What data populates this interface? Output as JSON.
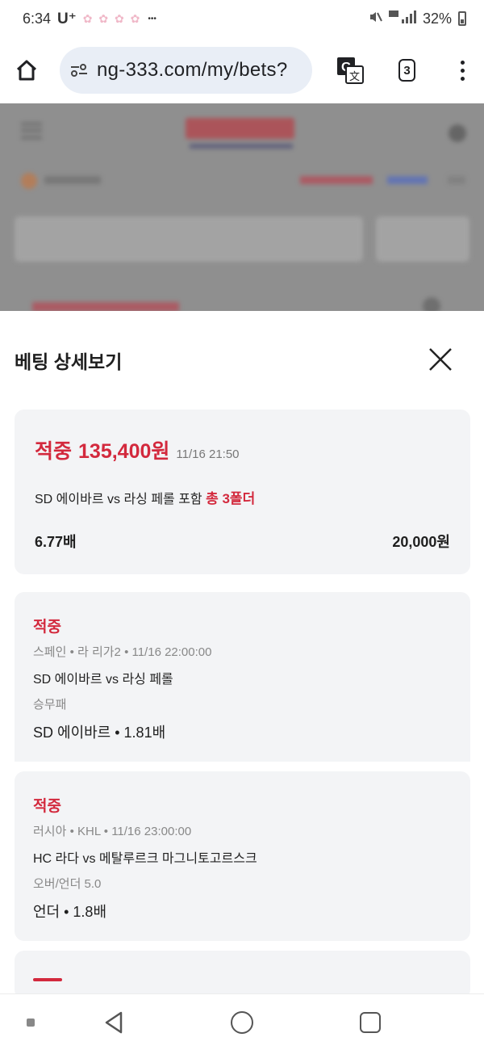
{
  "status_bar": {
    "time": "6:34",
    "carrier": "U⁺",
    "indicators": "✿ ✿ ✿ ✿",
    "more": "•••",
    "signal_text": "▏▎▍▌",
    "battery_percent": "32%"
  },
  "browser": {
    "url": "ng-333.com/my/bets?",
    "tab_count": "3"
  },
  "sheet": {
    "title": "베팅 상세보기"
  },
  "summary": {
    "status": "적중",
    "amount": "135,400원",
    "time": "11/16 21:50",
    "desc_prefix": "SD 에이바르 vs 라싱 페롤 포함",
    "folder_text": "총 3폴더",
    "odds": "6.77배",
    "stake": "20,000원"
  },
  "bets": [
    {
      "status": "적중",
      "league": "스페인 • 라 리가2 • 11/16 22:00:00",
      "match": "SD 에이바르 vs 라싱 페롤",
      "market": "승무패",
      "pick": "SD 에이바르 • 1.81배"
    },
    {
      "status": "적중",
      "league": "러시아 • KHL • 11/16 23:00:00",
      "match": "HC 라다 vs 메탈루르크 마그니토고르스크",
      "market": "오버/언더 5.0",
      "pick": "언더 • 1.8배"
    }
  ],
  "colors": {
    "accent_red": "#d3293d",
    "card_bg": "#f3f4f6",
    "url_bg": "#e9eef6"
  }
}
